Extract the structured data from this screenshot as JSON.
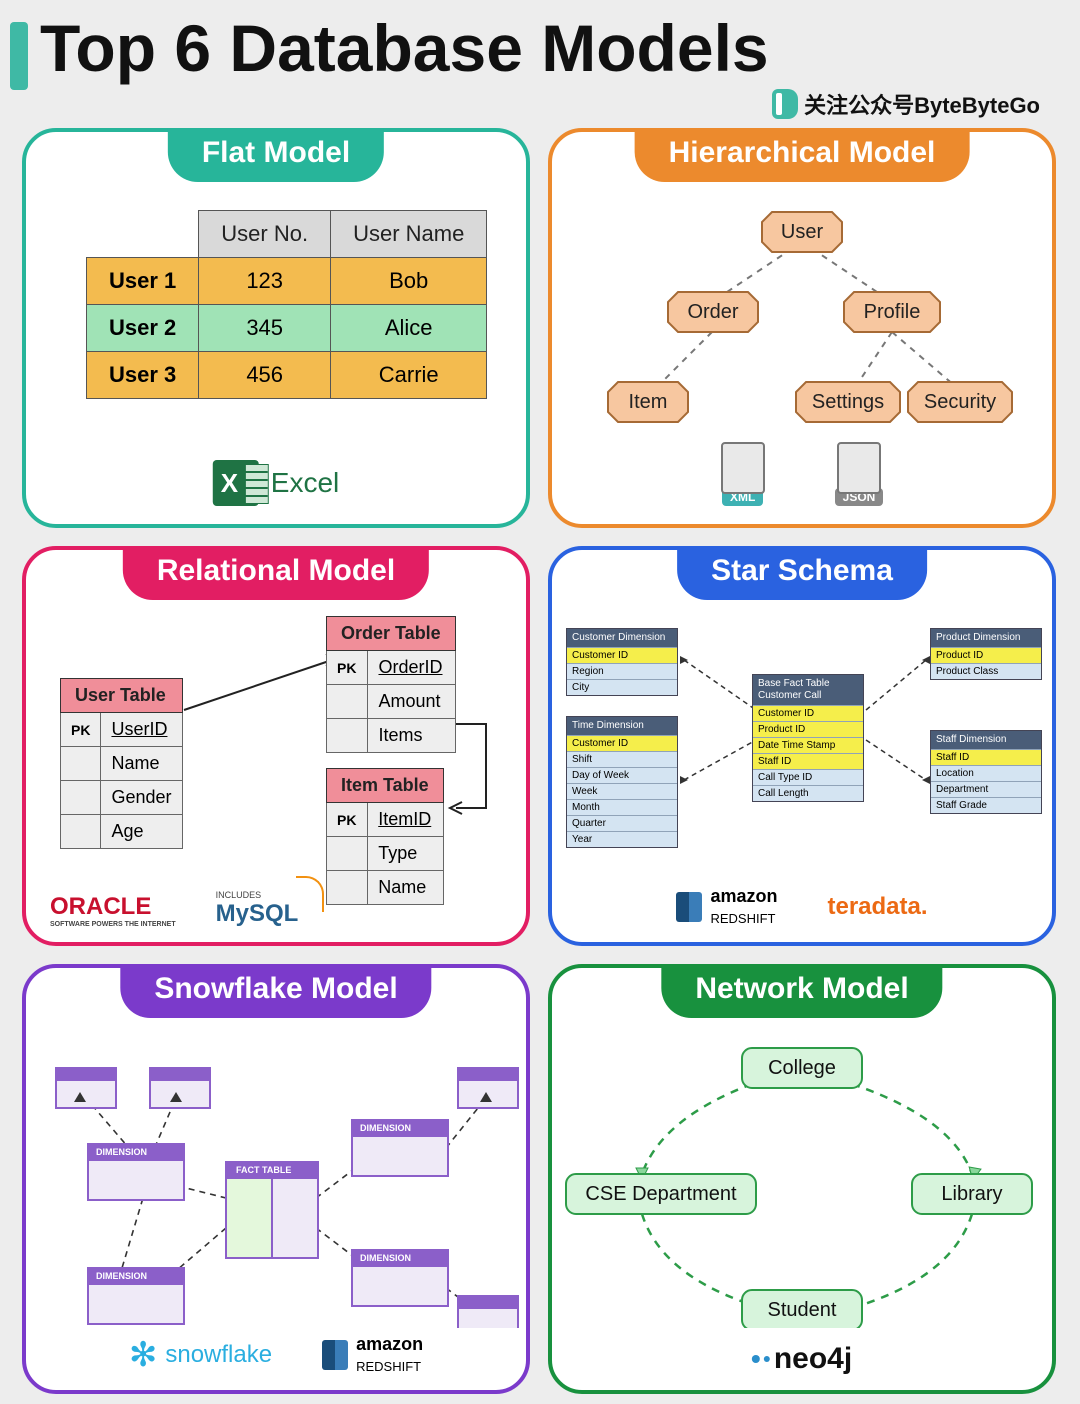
{
  "title": "Top 6 Database Models",
  "attribution": "关注公众号ByteByteGo",
  "cards": {
    "flat": {
      "title": "Flat Model",
      "headers": [
        "User No.",
        "User Name"
      ],
      "rows": [
        {
          "label": "User 1",
          "no": "123",
          "name": "Bob"
        },
        {
          "label": "User 2",
          "no": "345",
          "name": "Alice"
        },
        {
          "label": "User 3",
          "no": "456",
          "name": "Carrie"
        }
      ],
      "tech": "Excel"
    },
    "hier": {
      "title": "Hierarchical Model",
      "nodes": {
        "root": "User",
        "l1a": "Order",
        "l1b": "Profile",
        "l2a": "Item",
        "l2b": "Settings",
        "l2c": "Security"
      },
      "formats": [
        "XML",
        "JSON"
      ]
    },
    "rel": {
      "title": "Relational Model",
      "user": {
        "name": "User Table",
        "pk": "UserID",
        "cols": [
          "Name",
          "Gender",
          "Age"
        ]
      },
      "order": {
        "name": "Order Table",
        "pk": "OrderID",
        "cols": [
          "Amount",
          "Items"
        ]
      },
      "item": {
        "name": "Item Table",
        "pk": "ItemID",
        "cols": [
          "Type",
          "Name"
        ]
      },
      "logos": {
        "oracle": "ORACLE",
        "oracle_sub": "SOFTWARE POWERS THE INTERNET",
        "mysql": "MySQL",
        "mysql_sub": "INCLUDES"
      }
    },
    "star": {
      "title": "Star Schema",
      "dims": {
        "customer": {
          "title": "Customer Dimension",
          "rows": [
            "Customer ID",
            "Region",
            "City"
          ],
          "key": 0
        },
        "time": {
          "title": "Time Dimension",
          "rows": [
            "Customer ID",
            "Shift",
            "Day of Week",
            "Week",
            "Month",
            "Quarter",
            "Year"
          ],
          "key": 0
        },
        "fact": {
          "title": "Base Fact Table",
          "sub": "Customer Call",
          "rows": [
            "Customer ID",
            "Product ID",
            "Date Time Stamp",
            "Staff ID",
            "Call Type ID",
            "Call Length"
          ],
          "keys": [
            0,
            1,
            2,
            3
          ]
        },
        "product": {
          "title": "Product Dimension",
          "rows": [
            "Product ID",
            "Product Class"
          ],
          "key": 0
        },
        "staff": {
          "title": "Staff Dimension",
          "rows": [
            "Staff ID",
            "Location",
            "Department",
            "Staff Grade"
          ],
          "key": 0
        }
      },
      "logos": {
        "redshift1": "amazon",
        "redshift2": "REDSHIFT",
        "tera": "teradata."
      }
    },
    "snow": {
      "title": "Snowflake Model",
      "fact": "FACT TABLE",
      "dim": "DIMENSION",
      "logos": {
        "snow": "snowflake",
        "redshift1": "amazon",
        "redshift2": "REDSHIFT"
      }
    },
    "net": {
      "title": "Network Model",
      "nodes": {
        "top": "College",
        "left": "CSE Department",
        "right": "Library",
        "bottom": "Student"
      },
      "logo": "neo4j"
    }
  }
}
